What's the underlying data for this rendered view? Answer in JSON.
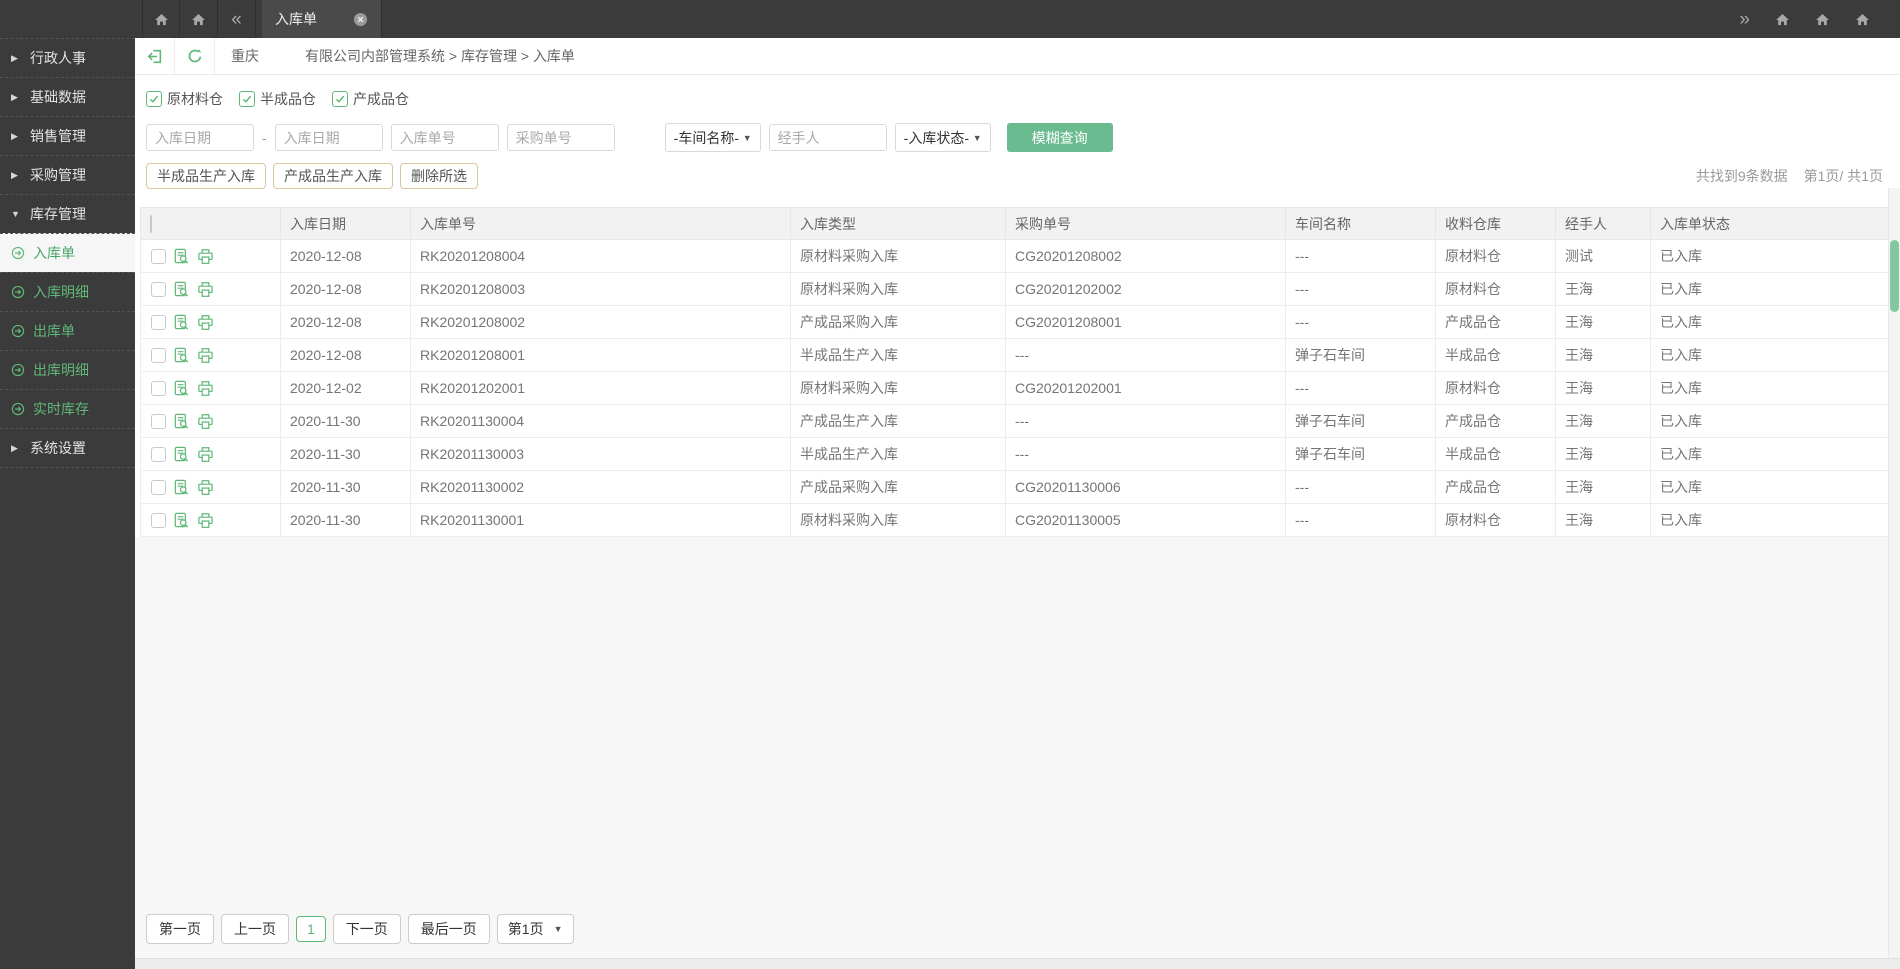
{
  "colors": {
    "accent": "#5fb878",
    "query_button": "#6abb90",
    "topbar_bg": "#3b3b3b",
    "tan_button_border": "#d9c89b"
  },
  "topbar": {
    "tab_label": "入库单"
  },
  "breadcrumb": {
    "city": "重庆",
    "path": "有限公司内部管理系统 > 库存管理 > 入库单"
  },
  "sidebar": {
    "items": [
      {
        "label": "行政人事"
      },
      {
        "label": "基础数据"
      },
      {
        "label": "销售管理"
      },
      {
        "label": "采购管理"
      },
      {
        "label": "库存管理"
      },
      {
        "label": "入库单"
      },
      {
        "label": "入库明细"
      },
      {
        "label": "出库单"
      },
      {
        "label": "出库明细"
      },
      {
        "label": "实时库存"
      },
      {
        "label": "系统设置"
      }
    ]
  },
  "warehouse_filters": {
    "raw": "原材料仓",
    "semi": "半成品仓",
    "finished": "产成品仓"
  },
  "search": {
    "date_from_placeholder": "入库日期",
    "date_separator": "-",
    "date_to_placeholder": "入库日期",
    "order_no_placeholder": "入库单号",
    "purchase_no_placeholder": "采购单号",
    "workshop_select": "-车间名称-",
    "handler_placeholder": "经手人",
    "status_select": "-入库状态-",
    "query_button": "模糊查询"
  },
  "actions": {
    "semi_inbound_button": "半成品生产入库",
    "finished_inbound_button": "产成品生产入库",
    "delete_button": "删除所选"
  },
  "summary": {
    "count": "共找到9条数据",
    "page": "第1页/ 共1页"
  },
  "table": {
    "columns": [
      "入库日期",
      "入库单号",
      "入库类型",
      "采购单号",
      "车间名称",
      "收料仓库",
      "经手人",
      "入库单状态"
    ],
    "rows": [
      [
        "2020-12-08",
        "RK20201208004",
        "原材料采购入库",
        "CG20201208002",
        "---",
        "原材料仓",
        "测试",
        "已入库"
      ],
      [
        "2020-12-08",
        "RK20201208003",
        "原材料采购入库",
        "CG20201202002",
        "---",
        "原材料仓",
        "王海",
        "已入库"
      ],
      [
        "2020-12-08",
        "RK20201208002",
        "产成品采购入库",
        "CG20201208001",
        "---",
        "产成品仓",
        "王海",
        "已入库"
      ],
      [
        "2020-12-08",
        "RK20201208001",
        "半成品生产入库",
        "---",
        "弹子石车间",
        "半成品仓",
        "王海",
        "已入库"
      ],
      [
        "2020-12-02",
        "RK20201202001",
        "原材料采购入库",
        "CG20201202001",
        "---",
        "原材料仓",
        "王海",
        "已入库"
      ],
      [
        "2020-11-30",
        "RK20201130004",
        "产成品生产入库",
        "---",
        "弹子石车间",
        "产成品仓",
        "王海",
        "已入库"
      ],
      [
        "2020-11-30",
        "RK20201130003",
        "半成品生产入库",
        "---",
        "弹子石车间",
        "半成品仓",
        "王海",
        "已入库"
      ],
      [
        "2020-11-30",
        "RK20201130002",
        "产成品采购入库",
        "CG20201130006",
        "---",
        "产成品仓",
        "王海",
        "已入库"
      ],
      [
        "2020-11-30",
        "RK20201130001",
        "原材料采购入库",
        "CG20201130005",
        "---",
        "原材料仓",
        "王海",
        "已入库"
      ]
    ]
  },
  "pagination": {
    "first": "第一页",
    "prev": "上一页",
    "current": "1",
    "next": "下一页",
    "last": "最后一页",
    "jump": "第1页"
  }
}
